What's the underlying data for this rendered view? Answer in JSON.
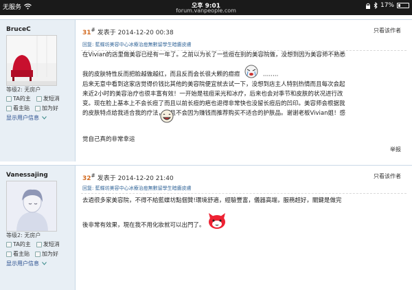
{
  "status_bar": {
    "carrier": "无服务",
    "time": "오후 9:01",
    "url": "forum.vanpeople.com",
    "battery": "17%"
  },
  "posts": [
    {
      "username": "BruceC",
      "floor_number": "31",
      "floor_sup": "#",
      "posted_at": "发表于 2014-12-20 00:38",
      "only_author": "只看该作者",
      "reply_quote": "回复: 藍蝶坊美容中心冰療治痘無數留學生暗瘡皮膚",
      "level_label": "等级2:",
      "level_value": "无房户",
      "actions": [
        "TA的主",
        "发短消",
        "看主贴",
        "加为好"
      ],
      "show_info": "显示用户信息",
      "body_lines": [
        "在Vivian的店里做美容已经有一年了。之前以为长了一些痘在别的美容院做，没想到因为美容师不熟悉",
        "我的皮肤特性反而把脸越做越红，而且反而会长很大颗的痘痘",
        "……..",
        "后来无意中看到这家店觉得价钱比其他的美容院便宜就去试一下，没想到店主人特别热情而且每次会起",
        "来近2小时的美容治疗也很丰富有效！一开始是祛痘采光和冰疗，后来也会对季节和皮肤的状况进行改",
        "变。现在脸上基本上不会长痘了而且以前长痘的疤也退得非常快也没留长痘后的凹印。美容师会根据我",
        "的皮肤特点给我适合我的疗法，而且不会因为赚钱而推荐购买不适合的护肤品。谢谢老板Vivian姐！感",
        "觉自己真的非常幸运"
      ],
      "report": "举报"
    },
    {
      "username": "Vanessajing",
      "floor_number": "32",
      "floor_sup": "#",
      "posted_at": "发表于 2014-12-20 21:40",
      "only_author": "只看该作者",
      "reply_quote": "回复: 藍蝶坊美容中心冰療治痘無數留學生暗瘡皮膚",
      "level_label": "等级2:",
      "level_value": "无房户",
      "actions": [
        "TA的主",
        "发短消",
        "看主贴",
        "加为好"
      ],
      "show_info": "显示用户信息",
      "body_lines": [
        "去過很多家美容院，不得不給藍蝶坊點個贊!環境舒適，經驗豐富，儀器高端，服務超好，關鍵是做完",
        "後非常有效果，現在我不用化妝就可以出門了。"
      ]
    }
  ],
  "icons": {
    "wifi": "wifi-icon",
    "lock": "lock-icon",
    "bluetooth": "bluetooth-icon",
    "battery": "battery-icon"
  },
  "colors": {
    "status_bar": "#1a1a1a",
    "sidebar_bg": "#e8eff5",
    "floor_number": "#d2691e",
    "link": "#336699"
  }
}
